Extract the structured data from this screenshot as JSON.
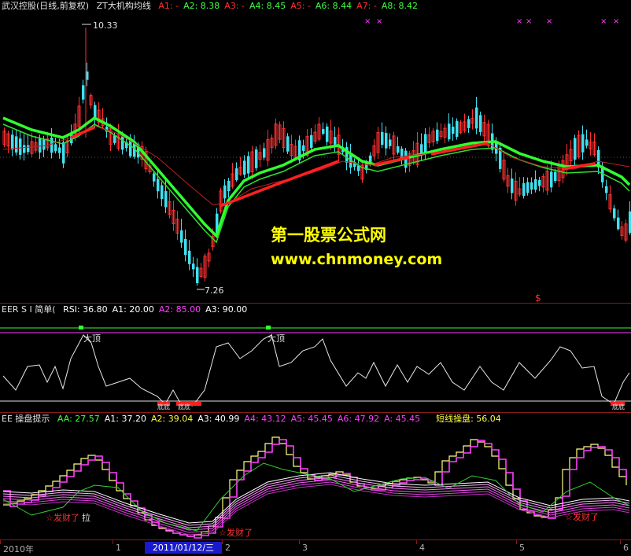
{
  "main_panel": {
    "title": "武汉控股(日线,前复权)",
    "indicator": "ZT大机构均线",
    "params": [
      {
        "label": "A1: -",
        "color": "#ff3030"
      },
      {
        "label": "A2: 8.38",
        "color": "#40ff40"
      },
      {
        "label": "A3: -",
        "color": "#ff3030"
      },
      {
        "label": "A4: 8.45",
        "color": "#40ff40"
      },
      {
        "label": "A5: -",
        "color": "#ff3030"
      },
      {
        "label": "A6: 8.44",
        "color": "#40ff40"
      },
      {
        "label": "A7: -",
        "color": "#ff3030"
      },
      {
        "label": "A8: 8.42",
        "color": "#40ff40"
      }
    ],
    "high_label": "10.33",
    "low_label": "7.26",
    "signal_mark": "$",
    "top_marks": [
      "×",
      "×",
      "×",
      "×",
      "×",
      "×",
      "×"
    ]
  },
  "watermark": {
    "line1": "第一股票公式网",
    "line2": "www.chnmoney.com"
  },
  "rsi_panel": {
    "title": "EER S I 简单(",
    "params": [
      {
        "label": "RSI: 36.80",
        "color": "#ffffff"
      },
      {
        "label": "A1: 20.00",
        "color": "#ffffff"
      },
      {
        "label": "A2: 85.00",
        "color": "#ff40ff"
      },
      {
        "label": "A3: 90.00",
        "color": "#ffffff"
      }
    ],
    "top_label": "大顶",
    "bottom_label": "底底"
  },
  "ops_panel": {
    "title": "EE 操盘提示",
    "params": [
      {
        "label": "AA: 27.57",
        "color": "#40ff40"
      },
      {
        "label": "A1: 37.20",
        "color": "#ffffff"
      },
      {
        "label": "A2: 39.04",
        "color": "#ffff40"
      },
      {
        "label": "A3: 40.99",
        "color": "#ffffff"
      },
      {
        "label": "A4: 43.12",
        "color": "#ff40ff"
      },
      {
        "label": "A5: 45.45",
        "color": "#ff40ff"
      },
      {
        "label": "A6: 47.92",
        "color": "#ff40ff"
      },
      {
        "label": "A: 45.45",
        "color": "#ff40ff"
      }
    ],
    "extra": {
      "label": "短线操盘: 56.04",
      "color": "#ffff40"
    },
    "signal_label": "发财了",
    "pull_label": "拉"
  },
  "timebar": {
    "labels": [
      {
        "text": "2010年",
        "pos": 4
      },
      {
        "text": "1",
        "pos": 147
      },
      {
        "text": "2",
        "pos": 286
      },
      {
        "text": "3",
        "pos": 384
      },
      {
        "text": "4",
        "pos": 533
      },
      {
        "text": "5",
        "pos": 660
      },
      {
        "text": "6",
        "pos": 792
      }
    ],
    "selected": "2011/01/12/三"
  }
}
